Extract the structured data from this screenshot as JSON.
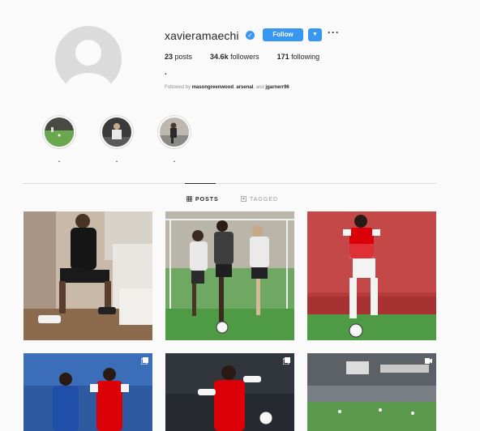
{
  "profile": {
    "username": "xavieramaechi",
    "verified": true,
    "follow_label": "Follow",
    "more_label": "···",
    "stats": {
      "posts_count": "23",
      "posts_label": "posts",
      "followers_count": "34.6k",
      "followers_label": "followers",
      "following_count": "171",
      "following_label": "following"
    },
    "bio": ".",
    "followed_by_prefix": "Followed by ",
    "followed_by_user1": "masongreenwood",
    "followed_by_sep": ", ",
    "followed_by_user2": "arsenal",
    "followed_by_and": ", and ",
    "followed_by_user3": "jgarnerr96"
  },
  "highlights": [
    {
      "label": "."
    },
    {
      "label": "."
    },
    {
      "label": "."
    }
  ],
  "tabs": [
    {
      "label": "POSTS",
      "active": true
    },
    {
      "label": "TAGGED",
      "active": false
    }
  ],
  "colors": {
    "accent": "#3897f0",
    "arsenal_red": "#db0007",
    "pitch_green": "#3f8f3a"
  },
  "posts": [
    {
      "type": "photo"
    },
    {
      "type": "photo"
    },
    {
      "type": "photo"
    },
    {
      "type": "carousel"
    },
    {
      "type": "carousel"
    },
    {
      "type": "video"
    }
  ]
}
